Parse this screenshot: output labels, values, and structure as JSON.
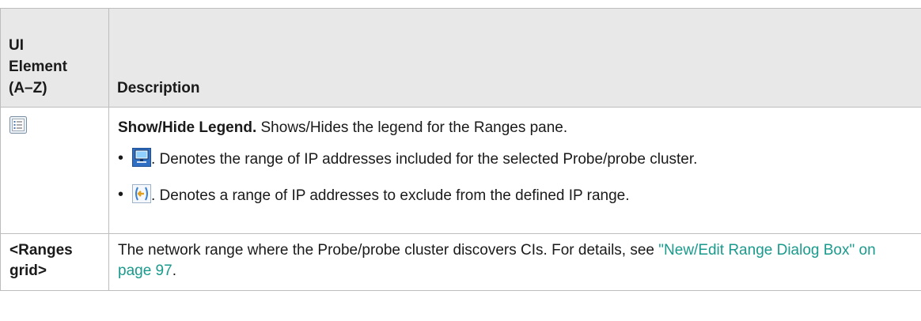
{
  "table": {
    "header": {
      "col1_line1": "UI",
      "col1_line2": "Element",
      "col1_line3": "(A–Z)",
      "col2": "Description"
    },
    "rows": [
      {
        "element_icon": "legend-list-icon",
        "title": "Show/Hide Legend.",
        "text": " Shows/Hides the legend for the Ranges pane.",
        "legend": [
          {
            "icon": "computer-monitor-icon",
            "text": ". Denotes the range of IP addresses included for the selected Probe/probe cluster."
          },
          {
            "icon": "exclude-range-icon",
            "text": ". Denotes a range of IP addresses to exclude from the defined IP range."
          }
        ]
      },
      {
        "element_line1": "<Ranges",
        "element_line2": "grid>",
        "text": "The network range where the Probe/probe cluster discovers CIs. For details, see ",
        "link": "\"New/Edit Range Dialog Box\" on page 97",
        "text_end": "."
      }
    ]
  },
  "colors": {
    "header_bg": "#e8e8e8",
    "border": "#bdbdbd",
    "link": "#1a9a8c"
  }
}
